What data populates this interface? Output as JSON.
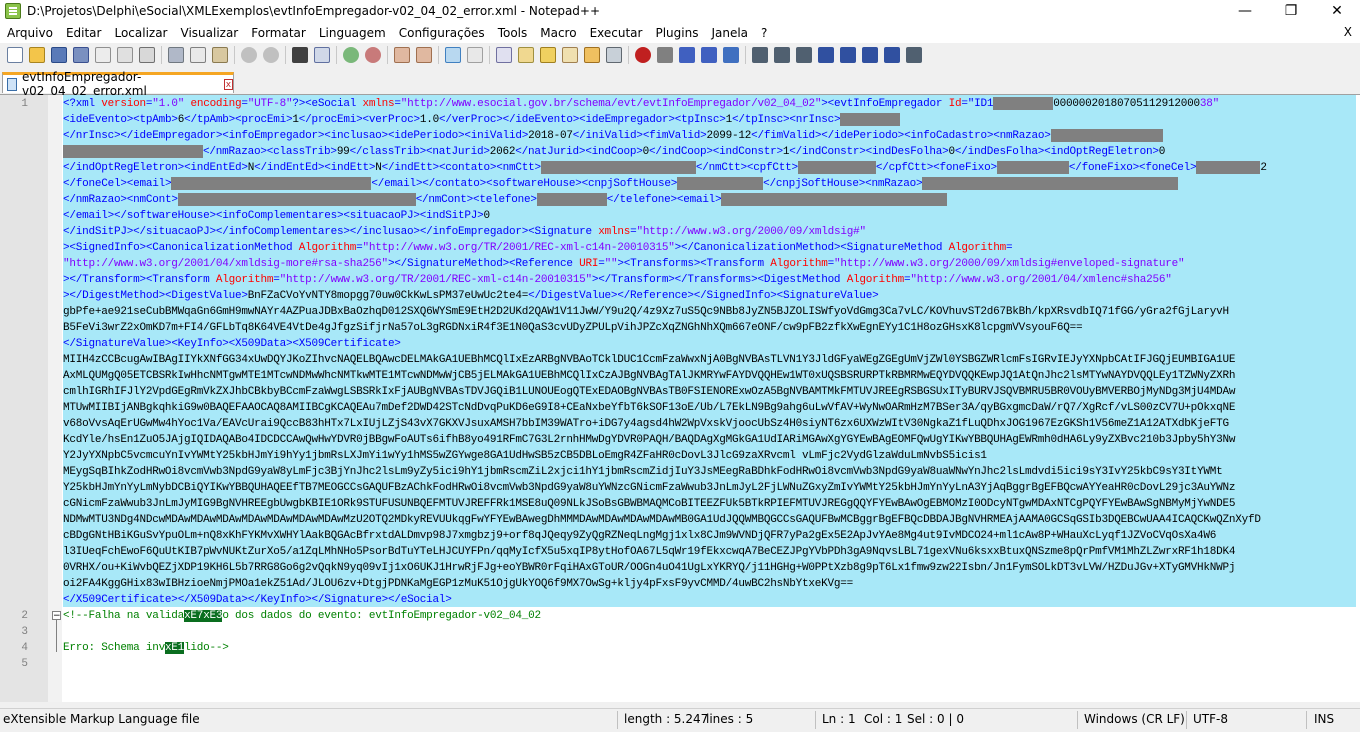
{
  "window": {
    "title": "D:\\Projetos\\Delphi\\eSocial\\XMLExemplos\\evtInfoEmpregador-v02_04_02_error.xml - Notepad++",
    "minimize": "—",
    "maximize": "❐",
    "close": "✕"
  },
  "menu": {
    "items": [
      "Arquivo",
      "Editar",
      "Localizar",
      "Visualizar",
      "Formatar",
      "Linguagem",
      "Configurações",
      "Tools",
      "Macro",
      "Executar",
      "Plugins",
      "Janela",
      "?"
    ],
    "close": "X"
  },
  "tab": {
    "label": "evtInfoEmpregador-v02_04_02_error.xml",
    "close": "x"
  },
  "editor": {
    "line_numbers": [
      "1",
      "2",
      "3",
      "4",
      "5"
    ],
    "comment_start": "<!--Falha na valida",
    "comment_hl1": "xE7",
    "comment_hl2": "xE3",
    "comment_rest": "o dos dados do evento: evtInfoEmpregador-v02_04_02",
    "err_start": "Erro: Schema inv",
    "err_hl": "xE1",
    "err_rest": "lido-->",
    "lines": [
      "<?xml version=\"1.0\" encoding=\"UTF-8\"?><eSocial xmlns=\"http://www.esocial.gov.br/schema/evt/evtInfoEmpregador/v02_04_02\"><evtInfoEmpregador Id=\"ID1",
      "<ideEvento><tpAmb>6</tpAmb><procEmi>1</procEmi><verProc>1.0</verProc></ideEvento><ideEmpregador><tpInsc>1</tpInsc><nrInsc>",
      "</nrInsc></ideEmpregador><infoEmpregador><inclusao><idePeriodo><iniValid>2018-07</iniValid><fimValid>2099-12</fimValid></idePeriodo><infoCadastro><nmRazao>",
      "</nmRazao><classTrib>99</classTrib><natJurid>2062</natJurid><indCoop>0</indCoop><indConstr>1</indConstr><indDesFolha>0</indDesFolha><indOptRegEletron>0",
      "</indOptRegEletron><indEntEd>N</indEntEd><indEtt>N</indEtt><contato><nmCtt>",
      "</foneCel><email>",
      "</nmRazao><nmCont>",
      "</email></softwareHouse><infoComplementares><situacaoPJ><indSitPJ>0",
      "</indSitPJ></situacaoPJ></infoComplementares></inclusao></infoEmpregador><Signature xmlns=\"http://www.w3.org/2000/09/xmldsig#\"",
      "><SignedInfo><CanonicalizationMethod Algorithm=\"http://www.w3.org/TR/2001/REC-xml-c14n-20010315\"></CanonicalizationMethod><SignatureMethod Algorithm=",
      "\"http://www.w3.org/2001/04/xmldsig-more#rsa-sha256\"></SignatureMethod><Reference URI=\"\"><Transforms><Transform Algorithm=\"http://www.w3.org/2000/09/xmldsig#enveloped-signature\"",
      "></Transform><Transform Algorithm=\"http://www.w3.org/TR/2001/REC-xml-c14n-20010315\"></Transform></Transforms><DigestMethod Algorithm=\"http://www.w3.org/2001/04/xmlenc#sha256\"",
      "></DigestMethod><DigestValue>BnFZaCVoYvNTY8mopgg70uw0CkKwLsPM37eUwUc2te4=</DigestValue></Reference></SignedInfo><SignatureValue>",
      "gbPfe+ae921seCubBMWqaGn6GmH9mwNAYr4AZPuaJDBxBaOzhqD012SXQ6WYSmE9EtH2D2UKd2QAW1V11JwW/Y9u2Q/4z9Xz7uS5Qc9NBb8JyZN5BJZOLISWfyoVdGmg3Ca7vLC/KOVhuvST2d67BkBh/kpXRsvdbIQ71fGG/yGra2fGjLaryvH",
      "B5FeVi3wrZ2xOmKD7m+FI4/GFLbTq8K64VE4VtDe4gJfgzSifjrNa57oL3gRGDNxiR4f3E1N0QaS3cvUDyZPULpVihJPZcXqZNGhNhXQm667eONF/cw9pFB2zfkXwEgnEYy1C1H8ozGHsxK8lcpgmVVsyouF6Q==",
      "</SignatureValue><KeyInfo><X509Data><X509Certificate>",
      "MIIH4zCCBcugAwIBAgIIYkXNfGG34xUwDQYJKoZIhvcNAQELBQAwcDELMAkGA1UEBhMCQlIxEzARBgNVBAoTCklDUC1CcmFzaWwxNjA0BgNVBAsTLVN1Y3JldGFyaWEgZGEgUmVjZWl0YSBGZWRlcmFsIGRvIEJyYXNpbCAtIFJGQjEUMBIGA1UE",
      "AxMLQUMgQ05ETCBSRkIwHhcNMTgwMTE1MTcwNDMwWhcNMTkwMTE1MTcwNDMwWjCB5jELMAkGA1UEBhMCQlIxCzAJBgNVBAgTAlJKMRYwFAYDVQQHEw1WT0xUQSBSRURPTkRBMRMwEQYDVQQKEwpJQ1AtQnJhc2lsMTYwNAYDVQQLEy1TZWNyZXRh",
      "cmlhIGRhIFJlY2VpdGEgRmVkZXJhbCBkbyBCcmFzaWwgLSBSRkIxFjAUBgNVBAsTDVJGQiB1LUNOUEogQTExEDAOBgNVBAsTB0FSIENORExwOzA5BgNVBAMTMkFMTUVJREEgRSBGSUxITyBURVJSQVBMRU5BR0VOUyBMVERBOjMyNDg3MjU4MDAw",
      "MTUwMIIBIjANBgkqhkiG9w0BAQEFAAOCAQ8AMIIBCgKCAQEAu7mDef2DWD42STcNdDvqPuKD6eG9I8+CEaNxbeYfbT6kSOF13oE/Ub/L7EkLN9Bg9ahg6uLwVfAV+WyNwOARmHzM7BSer3A/qyBGxgmcDaW/rQ7/XgRcf/vLS00zCV7U+pOkxqNE",
      "v68oVvsAqErUGwMw4hYoc1Va/EAVcUrai9QccB83hHTx7LxIUjLZjS43vX7GKXVJsuxAMSH7bbIM39WATro+iDG7y4agsd4hW2WpVxskVjoocUbSz4H0siyNT6zx6UXWzWItV30NgkaZ1fLuQDhxJOG1967EzGKSh1V56meZ1A12ATXdbKjeFTG",
      "KcdYle/hsEn1ZuO5JAjgIQIDAQABo4IDCDCCAwQwHwYDVR0jBBgwFoAUTs6ifhB8yo491RFmC7G3L2rnhHMwDgYDVR0PAQH/BAQDAgXgMGkGA1UdIARiMGAwXgYGYEwBAgEOMFQwUgYIKwYBBQUHAgEWRmh0dHA6Ly9yZXBvc210b3Jpby5hY3Nw",
      "Y2JyYXNpbC5vcmcuYnIvYWMtY25kbHJmYi9hYy1jbmRsLXJmYi1wYy1hMS5wZGYwge8GA1UdHwSB5zCB5DBLoEmgR4ZFaHR0cDovL3JlcG9zaXRvcml vLmFjc2VydGlzaWduLmNvbS5icis1",
      "MEygSqBIhkZodHRwOi8vcmVwb3NpdG9yaW8yLmFjc3BjYnJhc2lsLm9yZy5ici9hY1jbmRscmZiL2xjci1hY1jbmRscmZidjIuY3JsMEegRaBDhkFodHRwOi8vcmVwb3NpdG9yaW8uaWNwYnJhc2lsLmdvdi5ici9sY3IvY25kbC9sY3ItYWMt",
      "Y25kbHJmYnYyLmNybDCBiQYIKwYBBQUHAQEEfTB7MEOGCCsGAQUFBzAChkFodHRwOi8vcmVwb3NpdG9yaW8uYWNzcGNicmFzaWwub3JnLmJyL2FjLWNuZGxyZmIvYWMtY25kbHJmYnYyLnA3YjAqBggrBgEFBQcwAYYeaHR0cDovL29jc3AuYWNz",
      "cGNicmFzaWwub3JnLmJyMIG9BgNVHREEgbUwgbKBIE1ORk9STUFUSUNBQEFMTUVJREFFRk1MSE8uQ09NLkJSoBsGBWBMAQMCoBITEEZFUk5BTkRPIEFMTUVJREGgQQYFYEwBAwOgEBMOMzI0ODcyNTgwMDAxNTCgPQYFYEwBAwSgNBMyMjYwNDE5",
      "NDMwMTU3NDg4NDcwMDAwMDAwMDAwMDAwMDAwMDAwMDAwMzU2OTQ2MDkyREVUUkqgFwYFYEwBAwegDhMMMDAwMDAwMDAwMDAwMB0GA1UdJQQWMBQGCCsGAQUFBwMCBggrBgEFBQcDBDAJBgNVHRMEAjAAMA0GCSqGSIb3DQEBCwUAA4ICAQCKwQZnXyfD",
      "cBDgGNtHBiKGuSvYpuOLm+nQ8xKhFYKMvXWHYlAakBQGAcBfrxtdALDmvp98J7xmgbzj9+orf8qJQeqy9ZyQgRZNeqLngMgj1xlx8CJm9WVNDjQFR7yPa2gEx5E2ApJvYAe8Mg4ut9IvMDCO24+ml1cAw8P+WHauXcLyqf1JZVoCVqOsXa4W6",
      "l3IUeqFchEwoF6QuUtKIB7pWvNUKtZurXo5/a1ZqLMhNHo5PsorBdTuYTeLHJCUYFPn/qqMyIcfX5u5xqIP8ytHofOA67L5qWr19fEkxcwqA7BeCEZJPgYVbPDh3gA9NqvsLBL71gexVNu6ksxxBtuxQNSzme8pQrPmfVM1MhZLZwrxRF1h18DK4",
      "0VRHX/ou+KiWvbQEZjXDP19KH6L5b7RRG8Go6g2vQqkN9yq09vIj1xO6UKJ1HrwRjFJg+eoYBWR0rFqiHAxGToUR/OOGn4uO41UgLxYKRYQ/j11HGHg+W0PPtXzb8g9pT6Lx1fmw9zw22Isbn/Jn1FymSOLkDT3vLVW/HZDuJGv+XTyGMVHkNWPj",
      "oi2FA4KggGHix83wIBHzioeNmjPMOa1ekZ51Ad/JLOU6zv+DtgjPDNKaMgEGP1zMuK51OjgUkYOQ6f9MX7OwSg+kljy4pFxsF9yvCMMD/4uwBC2hsNbYtxeKVg==",
      "</X509Certificate></X509Data></KeyInfo></Signature></eSocial>"
    ]
  },
  "status": {
    "filetype": "eXtensible Markup Language file",
    "length": "length : 5.247",
    "lines": "lines : 5",
    "ln": "Ln : 1",
    "col": "Col : 1",
    "sel": "Sel : 0 | 0",
    "eol": "Windows (CR LF)",
    "encoding": "UTF-8",
    "mode": "INS"
  }
}
